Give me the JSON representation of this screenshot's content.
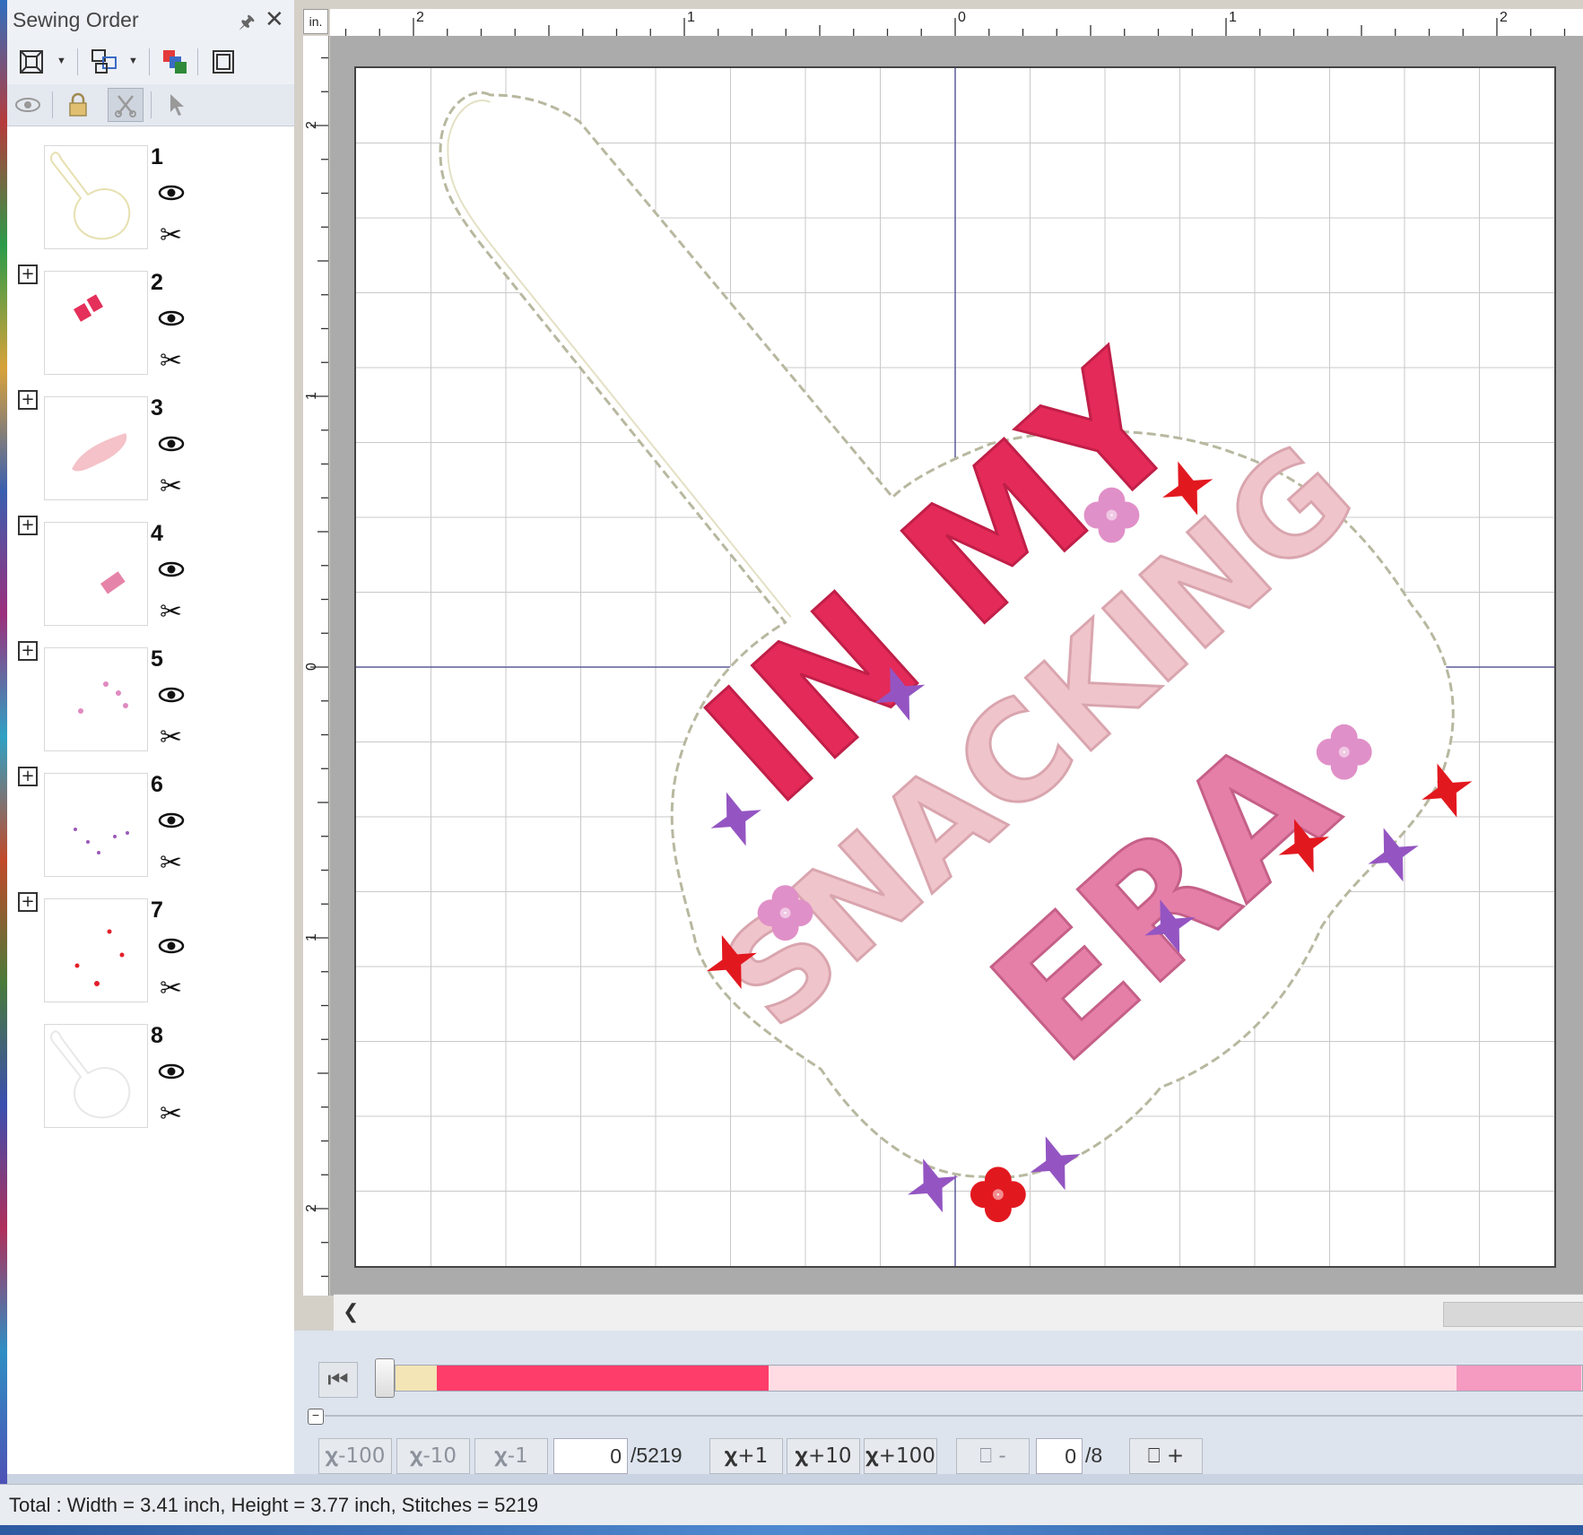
{
  "panel": {
    "title": "Sewing Order",
    "items": [
      {
        "number": "1",
        "expandable": false,
        "thread": "#e6e0b0"
      },
      {
        "number": "2",
        "expandable": true,
        "thread": "#e4305a"
      },
      {
        "number": "3",
        "expandable": true,
        "thread": "#f4c2c8"
      },
      {
        "number": "4",
        "expandable": true,
        "thread": "#e683a8"
      },
      {
        "number": "5",
        "expandable": true,
        "thread": "#e08ac0"
      },
      {
        "number": "6",
        "expandable": true,
        "thread": "#9a5ab8"
      },
      {
        "number": "7",
        "expandable": true,
        "thread": "#e31e2a"
      },
      {
        "number": "8",
        "expandable": false,
        "thread": "#e8e8e8"
      }
    ]
  },
  "ruler": {
    "unit": "in.",
    "h_labels": [
      "2",
      "1",
      "0",
      "1",
      "2"
    ],
    "v_labels": [
      "2",
      "1",
      "0",
      "1",
      "2"
    ]
  },
  "design": {
    "words": {
      "line1": "IN MY",
      "line2": "SNACKING",
      "line3": "ERA"
    },
    "colors": {
      "in": "#e42a58",
      "my": "#e42a58",
      "snacking": "#f0c4cb",
      "era": "#e57fa8",
      "purple": "#9455c2",
      "red": "#e2181f",
      "flower": "#e090c8"
    }
  },
  "stitch_controls": {
    "minus100": "-100",
    "minus10": "-10",
    "minus1": "-1",
    "stitch_value": "0",
    "stitch_total": "/5219",
    "plus1": "+1",
    "plus10": "+10",
    "plus100": "+100",
    "color_minus": "-",
    "color_value": "0",
    "color_total": "/8",
    "color_plus": "+"
  },
  "color_bar": [
    {
      "color": "#f3e5b5",
      "fraction": 0.035
    },
    {
      "color": "#ff3d6a",
      "fraction": 0.28
    },
    {
      "color": "#ffdce4",
      "fraction": 0.58
    },
    {
      "color": "#f59ac0",
      "fraction": 0.105
    }
  ],
  "status": {
    "text": "Total : Width = 3.41 inch, Height = 3.77 inch, Stitches = 5219"
  }
}
